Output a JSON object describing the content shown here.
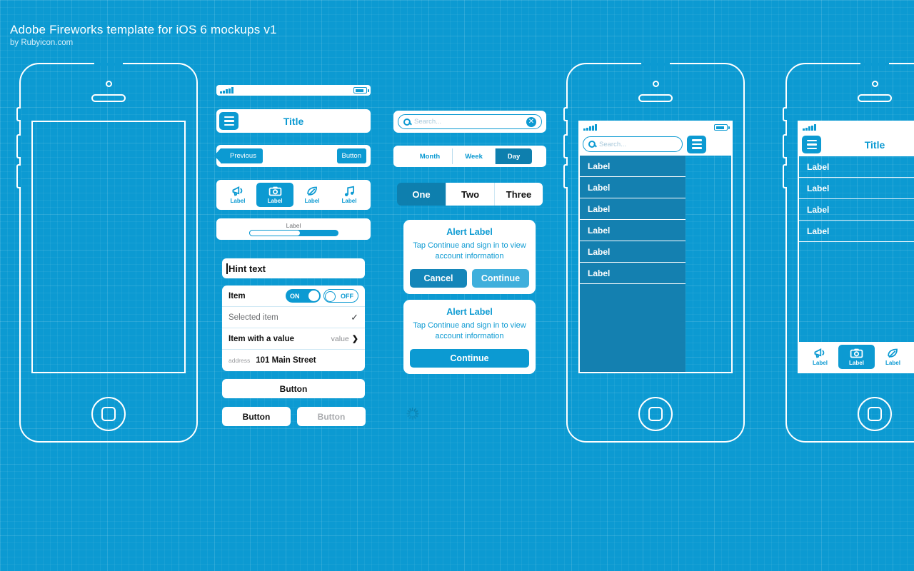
{
  "header": {
    "title": "Adobe Fireworks template for iOS 6 mockups v1",
    "byline": "by Rubyicon.com"
  },
  "colors": {
    "background": "#0c9ad2",
    "accent": "#0c9ad2",
    "accent_dark": "#0e7fae",
    "accent_light": "#3fafdc",
    "white": "#ffffff"
  },
  "icons": {
    "hamburger": "hamburger-icon",
    "search": "search-icon",
    "clear": "clear-icon",
    "check": "✓",
    "chevron": "❯",
    "close_x": "✕"
  },
  "phone1": {
    "name": "blank-phone-frame"
  },
  "phone2": {
    "navbar": {
      "title": "Title",
      "menu_icon": "hamburger-icon"
    },
    "prevbar": {
      "back_label": "Previous",
      "right_label": "Button"
    },
    "tabbar": {
      "items": [
        {
          "icon": "megaphone-icon",
          "label": "Label",
          "selected": false
        },
        {
          "icon": "camera-icon",
          "label": "Label",
          "selected": true
        },
        {
          "icon": "leaf-icon",
          "label": "Label",
          "selected": false
        },
        {
          "icon": "music-note-icon",
          "label": "Label",
          "selected": false
        }
      ]
    },
    "slider": {
      "label": "Label",
      "value_pct": 57
    },
    "textfield": {
      "value": "Hint text"
    },
    "list": {
      "rows": [
        {
          "label": "Item",
          "type": "toggles",
          "on_label": "ON",
          "off_label": "OFF"
        },
        {
          "label": "Selected item",
          "type": "check",
          "accessory": "✓"
        },
        {
          "label": "Item with a value",
          "type": "value",
          "value": "value",
          "accessory": "❯"
        },
        {
          "label": "address",
          "type": "address",
          "value": "101 Main Street"
        }
      ]
    },
    "buttons": {
      "wide": "Button",
      "left": "Button",
      "right_disabled": "Button"
    }
  },
  "phone3": {
    "search": {
      "placeholder": "Search...",
      "clear_icon": "clear-icon"
    },
    "segment_small": {
      "options": [
        "Month",
        "Week",
        "Day"
      ],
      "selected": "Day"
    },
    "segment_large": {
      "options": [
        "One",
        "Two",
        "Three"
      ],
      "selected": "One"
    },
    "alert_two_button": {
      "title": "Alert Label",
      "message": "Tap Continue and sign in to view account information",
      "buttons": [
        "Cancel",
        "Continue"
      ]
    },
    "alert_one_button": {
      "title": "Alert Label",
      "message": "Tap Continue and sign in to view account information",
      "buttons": [
        "Continue"
      ]
    },
    "spinner": {
      "name": "activity-spinner"
    }
  },
  "phone4": {
    "search": {
      "placeholder": "Search..."
    },
    "menu_icon": "hamburger-icon",
    "drawer_items": [
      "Label",
      "Label",
      "Label",
      "Label",
      "Label",
      "Label"
    ]
  },
  "phone5": {
    "navbar": {
      "title": "Title",
      "menu_icon": "hamburger-icon"
    },
    "list_items": [
      "Label",
      "Label",
      "Label",
      "Label"
    ],
    "tabbar": {
      "items": [
        {
          "icon": "megaphone-icon",
          "label": "Label",
          "selected": false
        },
        {
          "icon": "camera-icon",
          "label": "Label",
          "selected": true
        },
        {
          "icon": "leaf-icon",
          "label": "Label",
          "selected": false
        }
      ]
    }
  }
}
